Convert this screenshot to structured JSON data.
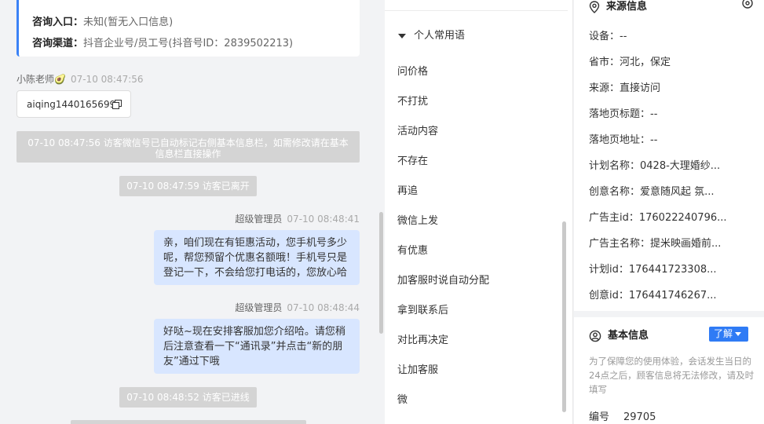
{
  "consult": {
    "entry_label": "咨询入口：",
    "entry_value": "未知(暂无入口信息)",
    "channel_label": "咨询渠道：",
    "channel_value": "抖音企业号/员工号(抖音号ID：2839502213)"
  },
  "messages": {
    "sender1_name": "小陈老师🥑",
    "sender1_time": "07-10 08:47:56",
    "wechat_id": "aiqing1440165699",
    "sys1": "07-10 08:47:56 访客微信号已自动标记右侧基本信息栏，如需修改请在基本信息栏直接操作",
    "sys2": "07-10 08:47:59 访客已离开",
    "admin_name": "超级管理员",
    "admin_time1": "07-10 08:48:41",
    "bubble1": "亲，咱们现在有钜惠活动，您手机号多少呢，帮您预留个优惠名额哦！手机号只是登记一下，不会给您打电话的，您放心哈",
    "admin_time2": "07-10 08:48:44",
    "bubble2": "好哒~现在安排客服加您介绍哈。请您稍后注意查看一下“通讯录”并点击“新的朋友”通过下哦",
    "sys3": "07-10 08:48:52 访客已进线"
  },
  "phrases": {
    "header": "个人常用语",
    "items": [
      "问价格",
      "不打扰",
      "活动内容",
      "不存在",
      "再追",
      "微信上发",
      "有优惠",
      "加客服时说自动分配",
      "拿到联系后",
      "对比再决定",
      "让加客服",
      "微"
    ]
  },
  "source": {
    "title": "来源信息",
    "rows": [
      "设备：--",
      "省市：河北，保定",
      "来源：直接访问",
      "落地页标题：--",
      "落地页地址：--",
      "计划名称：0428-大理婚纱...",
      "创意名称：爱意随风起 氛...",
      "广告主id：176022240796...",
      "广告主名称：提米映画婚前...",
      "计划id：176441723308...",
      "创意id：176441746267..."
    ]
  },
  "basic": {
    "title": "基本信息",
    "badge": "了解",
    "note": "为了保障您的使用体验，会话发生当日的24点之后，顾客信息将无法修改，请及时填写",
    "id_label": "编号",
    "id_value": "29705"
  }
}
